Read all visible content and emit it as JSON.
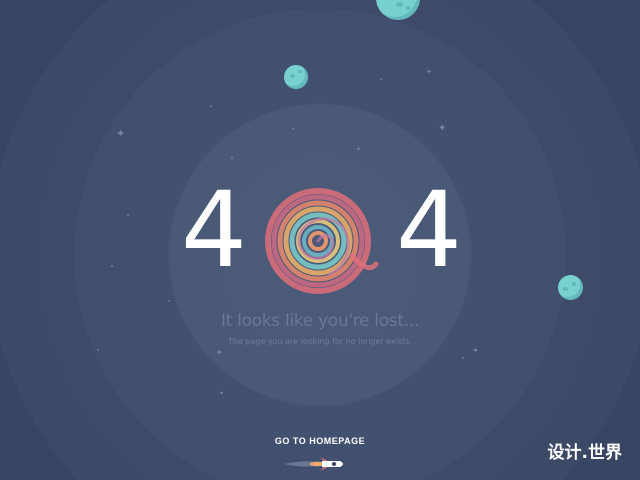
{
  "error": {
    "digit_left": "4",
    "digit_right": "4",
    "headline": "It looks like you're lost...",
    "subline": "The page you are looking for no longer exists."
  },
  "actions": {
    "home_label": "GO TO HOMEPAGE"
  },
  "watermark": {
    "text": "设计.世界"
  },
  "icons": [
    "swirl-zero-icon",
    "planet-icon",
    "star-icon",
    "rocket-icon"
  ],
  "colors": {
    "background": "#3a4863",
    "planet": "#79d1cf",
    "text_primary": "#ffffff",
    "text_muted": "#6b7894"
  }
}
